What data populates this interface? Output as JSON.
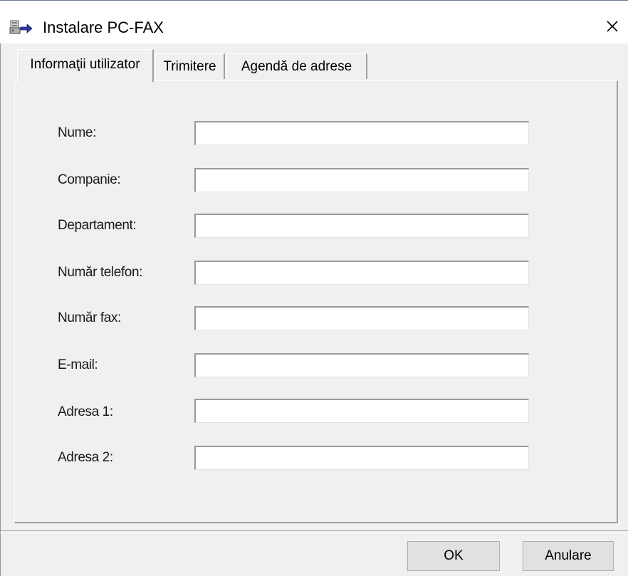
{
  "window": {
    "title": "Instalare PC-FAX",
    "close_glyph": "×"
  },
  "tabs": [
    {
      "label": "Informaţii utilizator",
      "active": true
    },
    {
      "label": "Trimitere",
      "active": false
    },
    {
      "label": "Agendă de adrese",
      "active": false
    }
  ],
  "form": {
    "fields": [
      {
        "label": "Nume:",
        "value": ""
      },
      {
        "label": "Companie:",
        "value": ""
      },
      {
        "label": "Departament:",
        "value": ""
      },
      {
        "label": "Număr telefon:",
        "value": ""
      },
      {
        "label": "Număr fax:",
        "value": ""
      },
      {
        "label": "E-mail:",
        "value": ""
      },
      {
        "label": "Adresa 1:",
        "value": ""
      },
      {
        "label": "Adresa 2:",
        "value": ""
      }
    ]
  },
  "buttons": {
    "ok_label": "OK",
    "cancel_label": "Anulare"
  },
  "icons": {
    "app": "fax-setup-icon",
    "close": "close-icon"
  }
}
